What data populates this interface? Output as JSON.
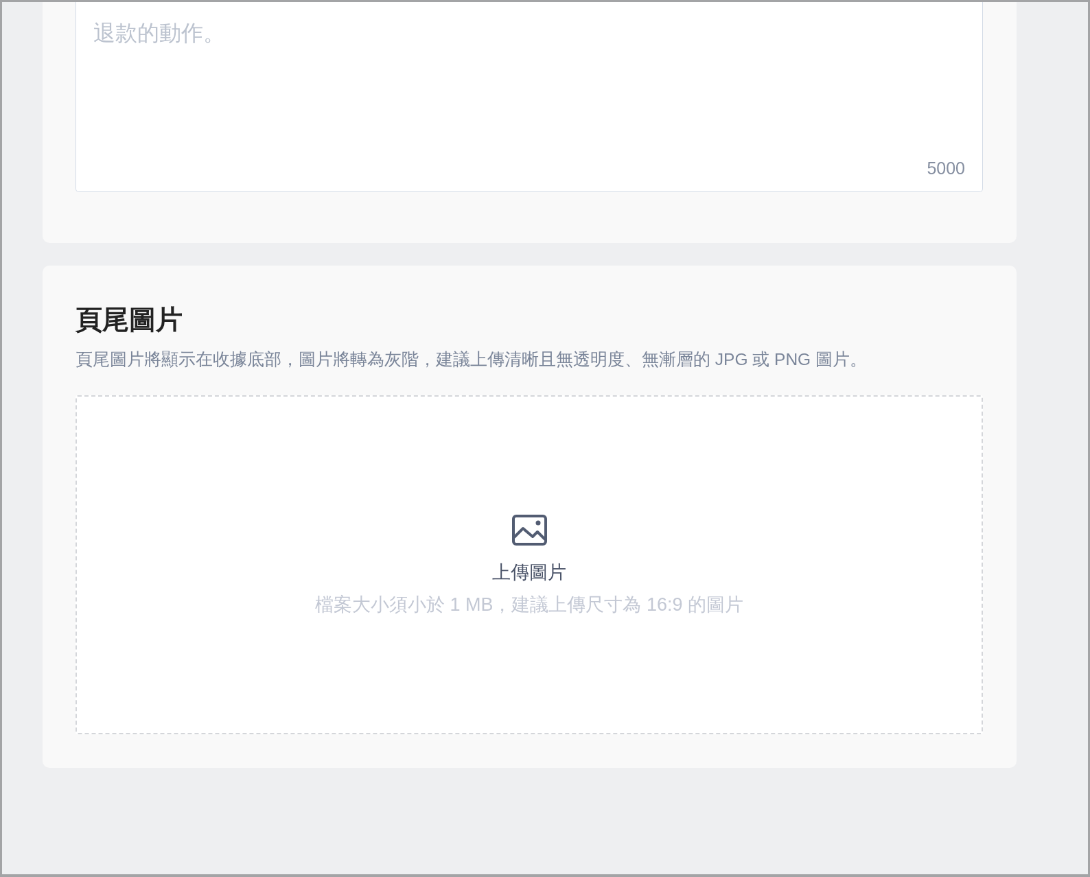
{
  "text_card": {
    "textarea": {
      "placeholder": "退款的動作。",
      "counter": "5000"
    }
  },
  "image_card": {
    "title": "頁尾圖片",
    "description": "頁尾圖片將顯示在收據底部，圖片將轉為灰階，建議上傳清晰且無透明度、無漸層的 JPG 或 PNG 圖片。",
    "upload_area": {
      "label": "上傳圖片",
      "hint": "檔案大小須小於 1 MB，建議上傳尺寸為 16:9 的圖片"
    }
  }
}
